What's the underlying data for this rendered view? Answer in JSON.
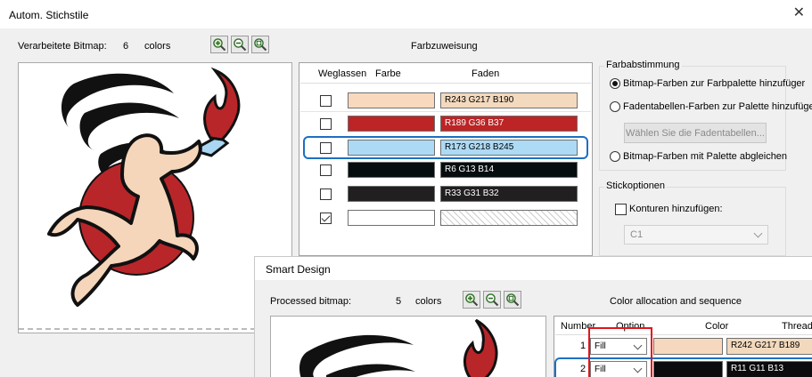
{
  "main_dialog": {
    "title": "Autom. Stichstile",
    "close_glyph": "✕",
    "bitmap_label": "Verarbeitete Bitmap:",
    "bitmap_count": "6",
    "bitmap_unit": "colors",
    "section_title": "Farbzuweisung",
    "table_headers": {
      "omit": "Weglassen",
      "color": "Farbe",
      "thread": "Faden"
    },
    "rows": [
      {
        "checked": false,
        "color": "#f9d9be",
        "thread": "R243 G217 B190",
        "thread_bg": "#f3d9be",
        "thread_fg": "#000000"
      },
      {
        "checked": false,
        "color": "#bd2425",
        "thread": "R189 G36 B37",
        "thread_bg": "#bd2425",
        "thread_fg": "#ffffff"
      },
      {
        "checked": false,
        "color": "#acdaf5",
        "thread": "R173 G218 B245",
        "thread_bg": "#addaf5",
        "thread_fg": "#000000"
      },
      {
        "checked": false,
        "color": "#060d0e",
        "thread": "R6 G13 B14",
        "thread_bg": "#060d0e",
        "thread_fg": "#ffffff"
      },
      {
        "checked": false,
        "color": "#211f20",
        "thread": "R33 G31 B32",
        "thread_bg": "#211f20",
        "thread_fg": "#ffffff"
      },
      {
        "checked": true,
        "color": "#ffffff",
        "thread": "",
        "thread_bg": "hatch",
        "thread_fg": "#000000"
      }
    ],
    "color_match": {
      "legend": "Farbabstimmung",
      "option1": "Bitmap-Farben zur Farbpalette hinzufüger",
      "option2": "Fadentabellen-Farben zur Palette hinzufüger",
      "select_tables_button": "Wählen Sie die Fadentabellen...",
      "option3": "Bitmap-Farben mit Palette abgleichen",
      "selected": 1
    },
    "stitch_options": {
      "legend": "Stickoptionen",
      "add_outlines": "Konturen hinzufügen:",
      "outline_value": "C1"
    }
  },
  "smart_dialog": {
    "title": "Smart Design",
    "bitmap_label": "Processed bitmap:",
    "bitmap_count": "5",
    "bitmap_unit": "colors",
    "section_title": "Color allocation and sequence",
    "table_headers": {
      "number": "Number",
      "option": "Option",
      "color": "Color",
      "thread": "Thread"
    },
    "rows": [
      {
        "number": "1",
        "option": "Fill",
        "color": "#f6d8be",
        "thread": "R242 G217 B189",
        "thread_bg": "#f2d9bd",
        "thread_fg": "#000000"
      },
      {
        "number": "2",
        "option": "Fill",
        "color": "#0b0b0d",
        "thread": "R11 G11 B13",
        "thread_bg": "#0b0b0d",
        "thread_fg": "#ffffff"
      }
    ]
  },
  "colors": {
    "accent": "#1e6fc1",
    "highlight": "#e0161c",
    "logo_red": "#b8262a",
    "logo_skin": "#f5d6bb",
    "logo_blue": "#a9d6f2"
  }
}
